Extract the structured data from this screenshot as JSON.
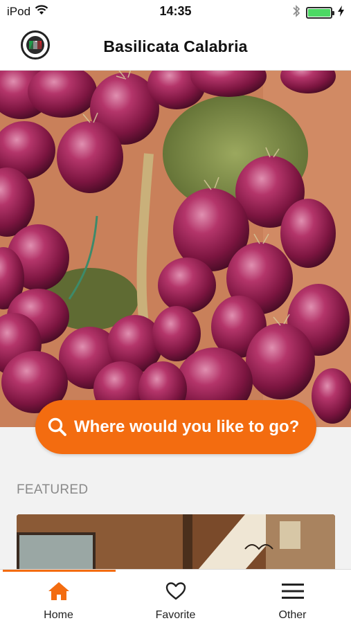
{
  "status_bar": {
    "carrier": "iPod",
    "time": "14:35"
  },
  "header": {
    "title": "Basilicata Calabria"
  },
  "search": {
    "label": "Where would you like to go?"
  },
  "featured": {
    "heading": "FEATURED"
  },
  "tab_bar": {
    "active_tab": "Home",
    "tabs": [
      {
        "label": "Home",
        "icon": "home-icon"
      },
      {
        "label": "Favorite",
        "icon": "heart-icon"
      },
      {
        "label": "Other",
        "icon": "menu-icon"
      }
    ]
  },
  "colors": {
    "accent": "#f36c10",
    "battery": "#4cd964",
    "section_background": "#f2f2f2"
  }
}
